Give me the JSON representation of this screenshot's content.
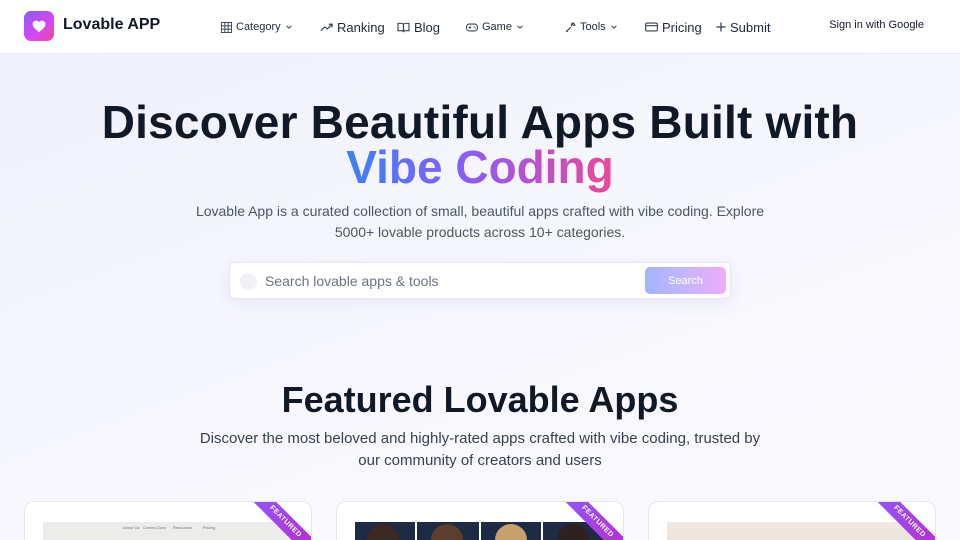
{
  "brand": {
    "name": "Lovable APP"
  },
  "nav": {
    "category": "Category",
    "ranking": "Ranking",
    "blog": "Blog",
    "game": "Game",
    "tools": "Tools",
    "pricing": "Pricing",
    "submit": "Submit",
    "signin": "Sign in with Google"
  },
  "hero": {
    "title_line1": "Discover Beautiful Apps Built with",
    "title_line2": "Vibe Coding",
    "subtitle": "Lovable App is a curated collection of small, beautiful apps crafted with vibe coding. Explore 5000+ lovable products across 10+ categories."
  },
  "search": {
    "placeholder": "Search lovable apps & tools",
    "button": "Search"
  },
  "featured": {
    "title": "Featured Lovable Apps",
    "subtitle": "Discover the most beloved and highly-rated apps crafted with vibe coding, trusted by our community of creators and users",
    "ribbon": "FEATURED",
    "card1_nav": [
      "About Us",
      "Combo Dora",
      "Resources",
      "Pricing"
    ]
  },
  "colors": {
    "accent_blue": "#3b82f6",
    "accent_purple": "#8b5cf6",
    "accent_pink": "#ec4899"
  },
  "icons": [
    "heart-icon",
    "grid-icon",
    "trending-icon",
    "book-icon",
    "gamepad-icon",
    "wrench-icon",
    "card-icon",
    "plus-icon",
    "chevron-down-icon",
    "search-icon"
  ]
}
